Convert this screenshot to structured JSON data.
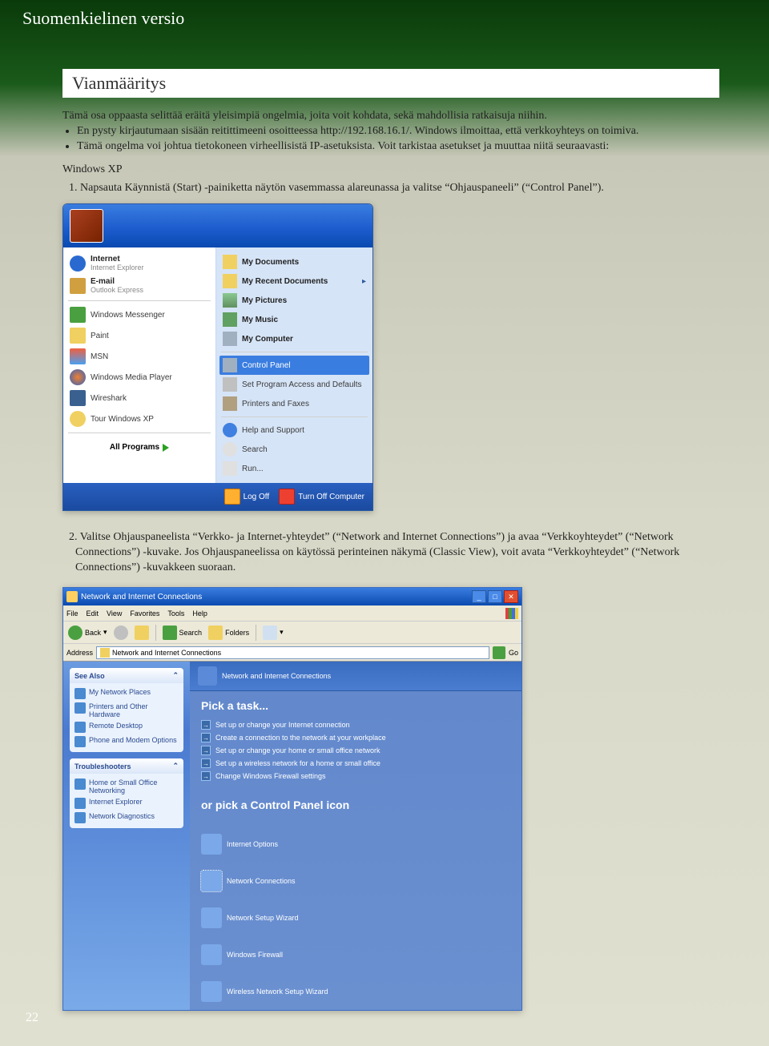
{
  "page": {
    "header": "Suomenkielinen versio",
    "number": "22"
  },
  "section": {
    "title": "Vianmääritys",
    "intro": "Tämä osa oppaasta selittää eräitä yleisimpiä ongelmia, joita voit kohdata, sekä mahdollisia ratkaisuja niihin.",
    "bullets": [
      "En pysty kirjautumaan sisään reitittimeeni osoitteessa http://192.168.16.1/. Windows ilmoittaa, että verkkoyhteys on toimiva.",
      "Tämä ongelma voi johtua tietokoneen virheellisistä IP-asetuksista. Voit tarkistaa asetukset ja muuttaa niitä seuraavasti:"
    ],
    "subhead": "Windows XP",
    "step1": "1. Napsauta Käynnistä (Start) -painiketta näytön vasemmassa alareunassa ja valitse “Ohjauspaneeli” (“Control Panel”).",
    "step2_text": "2. Valitse Ohjauspaneelista “Verkko- ja Internet-yhteydet” (“Network and Internet Connections”) ja avaa “Verkkoyhteydet” (“Network Connections”) -kuvake. Jos Ohjauspaneelissa on käytössä perinteinen näkymä (Classic View), voit avata “Verkkoyhteydet” (“Network Connections”) -kuvakkeen suoraan."
  },
  "startmenu": {
    "left_pinned": [
      {
        "name": "internet",
        "title": "Internet",
        "sub": "Internet Explorer",
        "icon": "ic-ie"
      },
      {
        "name": "email",
        "title": "E-mail",
        "sub": "Outlook Express",
        "icon": "ic-mail"
      }
    ],
    "left_recent": [
      {
        "name": "messenger",
        "label": "Windows Messenger",
        "icon": "ic-messenger"
      },
      {
        "name": "paint",
        "label": "Paint",
        "icon": "ic-paint"
      },
      {
        "name": "msn",
        "label": "MSN",
        "icon": "ic-msn"
      },
      {
        "name": "wmp",
        "label": "Windows Media Player",
        "icon": "ic-wmp"
      },
      {
        "name": "wireshark",
        "label": "Wireshark",
        "icon": "ic-wireshark"
      },
      {
        "name": "tour",
        "label": "Tour Windows XP",
        "icon": "ic-tour"
      }
    ],
    "all_programs": "All Programs",
    "right_top": [
      {
        "name": "mydocs",
        "label": "My Documents",
        "bold": true,
        "icon": "ic-folder"
      },
      {
        "name": "recent",
        "label": "My Recent Documents",
        "bold": true,
        "icon": "ic-folder",
        "arrow": true
      },
      {
        "name": "mypics",
        "label": "My Pictures",
        "bold": true,
        "icon": "ic-pics"
      },
      {
        "name": "mymusic",
        "label": "My Music",
        "bold": true,
        "icon": "ic-music"
      },
      {
        "name": "mycomputer",
        "label": "My Computer",
        "bold": true,
        "icon": "ic-computer"
      }
    ],
    "right_mid": [
      {
        "name": "controlpanel",
        "label": "Control Panel",
        "icon": "ic-computer",
        "selected": true
      },
      {
        "name": "defaults",
        "label": "Set Program Access and Defaults",
        "icon": "ic-defaults"
      },
      {
        "name": "printers",
        "label": "Printers and Faxes",
        "icon": "ic-printers"
      }
    ],
    "right_bot": [
      {
        "name": "help",
        "label": "Help and Support",
        "icon": "ic-help"
      },
      {
        "name": "search",
        "label": "Search",
        "icon": "ic-search"
      },
      {
        "name": "run",
        "label": "Run...",
        "icon": "ic-run"
      }
    ],
    "footer": {
      "logoff": "Log Off",
      "turnoff": "Turn Off Computer"
    }
  },
  "cpwin": {
    "title": "Network and Internet Connections",
    "menus": [
      "File",
      "Edit",
      "View",
      "Favorites",
      "Tools",
      "Help"
    ],
    "toolbar": {
      "back": "Back",
      "search": "Search",
      "folders": "Folders"
    },
    "address_label": "Address",
    "address_value": "Network and Internet Connections",
    "go": "Go",
    "sidepanels": {
      "seealso": {
        "title": "See Also",
        "items": [
          "My Network Places",
          "Printers and Other Hardware",
          "Remote Desktop",
          "Phone and Modem Options"
        ]
      },
      "trouble": {
        "title": "Troubleshooters",
        "items": [
          "Home or Small Office Networking",
          "Internet Explorer",
          "Network Diagnostics"
        ]
      }
    },
    "main": {
      "header": "Network and Internet Connections",
      "pick_task": "Pick a task...",
      "tasks": [
        "Set up or change your Internet connection",
        "Create a connection to the network at your workplace",
        "Set up or change your home or small office network",
        "Set up a wireless network for a home or small office",
        "Change Windows Firewall settings"
      ],
      "or_pick": "or pick a Control Panel icon",
      "icons": [
        {
          "name": "internet-options",
          "label": "Internet Options"
        },
        {
          "name": "network-connections",
          "label": "Network Connections",
          "selected": true
        },
        {
          "name": "network-setup-wizard",
          "label": "Network Setup Wizard"
        },
        {
          "name": "windows-firewall",
          "label": "Windows Firewall"
        },
        {
          "name": "wireless-network-setup-wizard",
          "label": "Wireless Network Setup Wizard"
        }
      ]
    }
  }
}
